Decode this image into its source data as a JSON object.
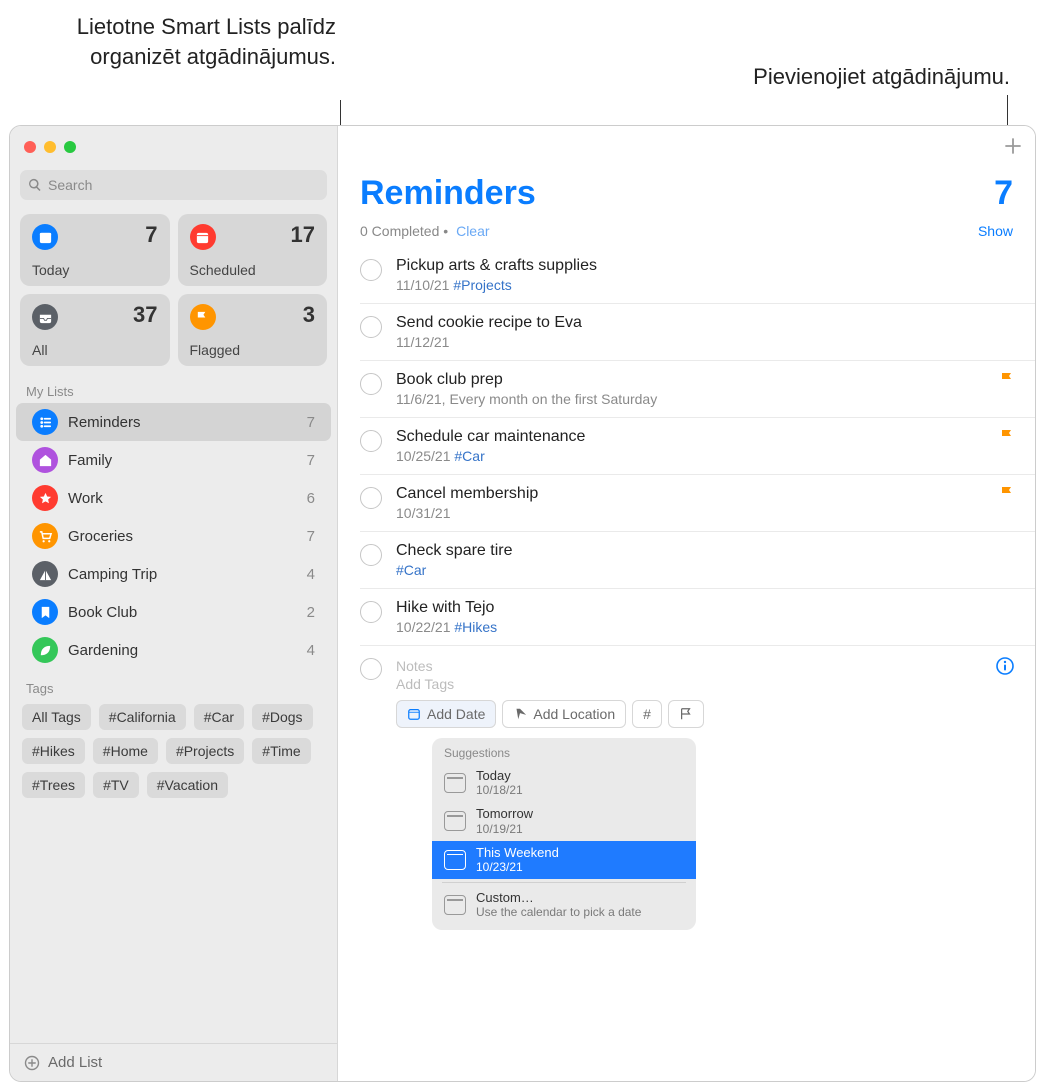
{
  "callouts": {
    "smartlists": "Lietotne Smart Lists palīdz organizēt atgādinājumus.",
    "add": "Pievienojiet atgādinājumu."
  },
  "search": {
    "placeholder": "Search"
  },
  "smart": [
    {
      "label": "Today",
      "count": "7",
      "color": "#0a7dff",
      "icon": "calendar-icon"
    },
    {
      "label": "Scheduled",
      "count": "17",
      "color": "#ff3b30",
      "icon": "calendar-grid-icon"
    },
    {
      "label": "All",
      "count": "37",
      "color": "#5b6067",
      "icon": "tray-icon"
    },
    {
      "label": "Flagged",
      "count": "3",
      "color": "#ff9500",
      "icon": "flag-icon"
    }
  ],
  "sections": {
    "mylists": "My Lists",
    "tags": "Tags"
  },
  "lists": [
    {
      "name": "Reminders",
      "count": "7",
      "color": "#0a7dff",
      "icon": "list-icon",
      "selected": true
    },
    {
      "name": "Family",
      "count": "7",
      "color": "#af52de",
      "icon": "home-icon"
    },
    {
      "name": "Work",
      "count": "6",
      "color": "#ff3b30",
      "icon": "star-icon"
    },
    {
      "name": "Groceries",
      "count": "7",
      "color": "#ff9500",
      "icon": "cart-icon"
    },
    {
      "name": "Camping Trip",
      "count": "4",
      "color": "#5b6067",
      "icon": "tent-icon"
    },
    {
      "name": "Book Club",
      "count": "2",
      "color": "#0a7dff",
      "icon": "bookmark-icon"
    },
    {
      "name": "Gardening",
      "count": "4",
      "color": "#34c759",
      "icon": "leaf-icon"
    }
  ],
  "tags": [
    "All Tags",
    "#California",
    "#Car",
    "#Dogs",
    "#Hikes",
    "#Home",
    "#Projects",
    "#Time",
    "#Trees",
    "#TV",
    "#Vacation"
  ],
  "addList": "Add List",
  "header": {
    "title": "Reminders",
    "count": "7"
  },
  "subheader": {
    "completed": "0 Completed",
    "dot": " • ",
    "clear": "Clear",
    "show": "Show"
  },
  "reminders": [
    {
      "title": "Pickup arts & crafts supplies",
      "date": "11/10/21",
      "tag": "#Projects"
    },
    {
      "title": "Send cookie recipe to Eva",
      "date": "11/12/21"
    },
    {
      "title": "Book club prep",
      "date": "11/6/21, Every month on the first Saturday",
      "flagged": true
    },
    {
      "title": "Schedule car maintenance",
      "date": "10/25/21",
      "tag": "#Car",
      "flagged": true
    },
    {
      "title": "Cancel membership",
      "date": "10/31/21",
      "flagged": true
    },
    {
      "title": "Check spare tire",
      "tag": "#Car"
    },
    {
      "title": "Hike with Tejo",
      "date": "10/22/21",
      "tag": "#Hikes"
    }
  ],
  "newReminder": {
    "notes": "Notes",
    "addTags": "Add Tags"
  },
  "quick": {
    "addDate": "Add Date",
    "addLocation": "Add Location"
  },
  "suggestions": {
    "title": "Suggestions",
    "items": [
      {
        "label": "Today",
        "date": "10/18/21"
      },
      {
        "label": "Tomorrow",
        "date": "10/19/21"
      },
      {
        "label": "This Weekend",
        "date": "10/23/21",
        "selected": true
      },
      {
        "label": "Custom…",
        "date": "Use the calendar to pick a date",
        "sep": true
      }
    ]
  }
}
